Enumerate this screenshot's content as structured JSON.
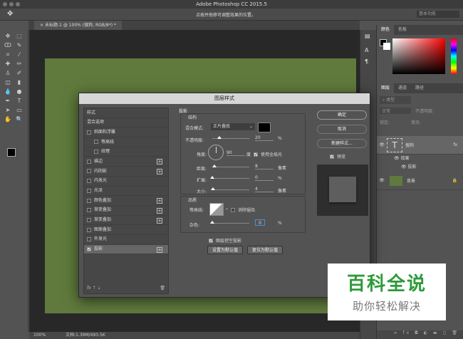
{
  "app": {
    "title": "Adobe Photoshop CC 2015.5",
    "hint": "点按并拖移可调整效果的位置。",
    "workspace": "基本功能",
    "doc_tab": "未标题-1 @ 100% (搜狗, RGB/8*) *"
  },
  "status": {
    "zoom": "100%",
    "doc": "文档:1.39M/493.5K"
  },
  "panels": {
    "color_tabs": [
      "颜色",
      "色板"
    ],
    "layer_tabs": [
      "图层",
      "通道",
      "路径"
    ],
    "kind": "类型",
    "blend": "正常",
    "opacity_label": "不透明度:",
    "lock_label": "锁定:",
    "fill_label": "填充:",
    "layers": [
      {
        "name": "搜狗",
        "effects_label": "效果",
        "effect": "投影"
      },
      {
        "name": "背景"
      }
    ]
  },
  "dialog": {
    "title": "图层样式",
    "styles": [
      {
        "label": "样式"
      },
      {
        "label": "混合选项"
      },
      {
        "label": "斜面和浮雕",
        "cb": true
      },
      {
        "label": "等高线",
        "cb": true,
        "indent": true
      },
      {
        "label": "纹理",
        "cb": true,
        "indent": true
      },
      {
        "label": "描边",
        "cb": true,
        "plus": true
      },
      {
        "label": "内阴影",
        "cb": true,
        "plus": true
      },
      {
        "label": "内发光",
        "cb": true
      },
      {
        "label": "光泽",
        "cb": true
      },
      {
        "label": "颜色叠加",
        "cb": true,
        "plus": true
      },
      {
        "label": "渐变叠加",
        "cb": true,
        "plus": true
      },
      {
        "label": "渐变叠加",
        "cb": true,
        "plus": true
      },
      {
        "label": "图案叠加",
        "cb": true
      },
      {
        "label": "外发光",
        "cb": true
      },
      {
        "label": "投影",
        "cb": true,
        "checked": true,
        "plus": true,
        "active": true
      }
    ],
    "fx": "fx",
    "section": "投影",
    "structure": "结构",
    "blend_label": "混合模式:",
    "blend_value": "正片叠底",
    "opacity_label": "不透明度:",
    "opacity": "20",
    "opacity_pct": 20,
    "pct": "%",
    "angle_label": "角度:",
    "angle": "90",
    "deg": "度",
    "global_light": "使用全局光",
    "distance_label": "距离:",
    "distance": "8",
    "px": "像素",
    "spread_label": "扩展:",
    "spread": "0",
    "size_label": "大小:",
    "size": "4",
    "quality": "品质",
    "contour_label": "等高线:",
    "antialias": "消除锯齿",
    "noise_label": "杂色:",
    "noise": "0",
    "knockout": "图层挖空投影",
    "set_default": "设置为默认值",
    "reset_default": "复位为默认值",
    "ok": "确定",
    "cancel": "取消",
    "new_style": "新建样式...",
    "preview": "预览"
  },
  "watermark": {
    "title": "百科全说",
    "subtitle": "助你轻松解决",
    "title_color": "#2e9a3a"
  }
}
